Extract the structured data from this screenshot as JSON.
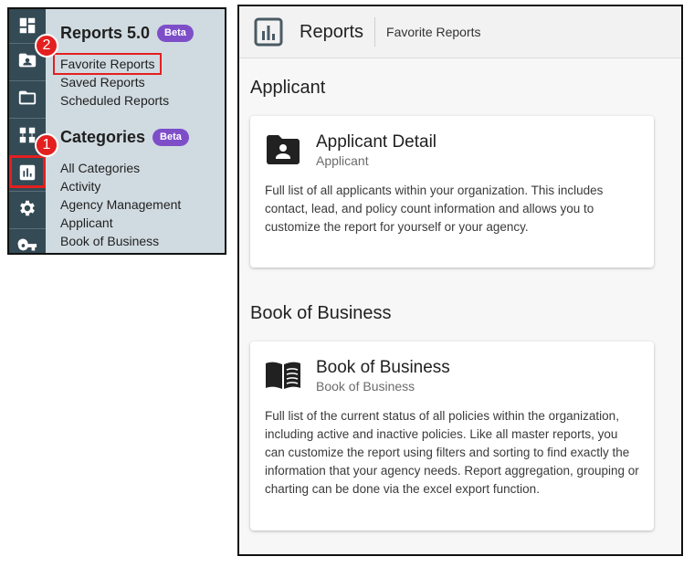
{
  "sidebar": {
    "rail_icons": [
      "dashboard-icon",
      "contact-card-icon",
      "folder-icon",
      "org-chart-icon",
      "reports-icon",
      "settings-icon",
      "key-icon"
    ],
    "reports_heading": "Reports 5.0",
    "reports_badge": "Beta",
    "reports_links": [
      "Favorite Reports",
      "Saved Reports",
      "Scheduled Reports"
    ],
    "categories_heading": "Categories",
    "categories_badge": "Beta",
    "category_links": [
      "All Categories",
      "Activity",
      "Agency Management",
      "Applicant",
      "Book of Business"
    ],
    "step_badges": [
      "1",
      "2"
    ]
  },
  "header": {
    "title": "Reports",
    "breadcrumb": "Favorite Reports"
  },
  "sections": [
    {
      "title": "Applicant",
      "card": {
        "icon": "account-box-folder-icon",
        "title": "Applicant Detail",
        "subtitle": "Applicant",
        "description": "Full list of all applicants within your organization. This includes contact, lead, and policy count information and allows you to customize the report for yourself or your agency."
      }
    },
    {
      "title": "Book of Business",
      "card": {
        "icon": "open-book-icon",
        "title": "Book of Business",
        "subtitle": "Book of Business",
        "description": "Full list of the current status of all policies within the organization, including active and inactive policies. Like all master reports, you can customize the report using filters and sorting to find exactly the information that your agency needs. Report aggregation, grouping or charting can be done via the excel export function."
      }
    }
  ],
  "colors": {
    "rail": "#344a55",
    "nav_bg": "#d0dbe1",
    "badge": "#7e4ec9",
    "highlight": "#e41f1f"
  }
}
